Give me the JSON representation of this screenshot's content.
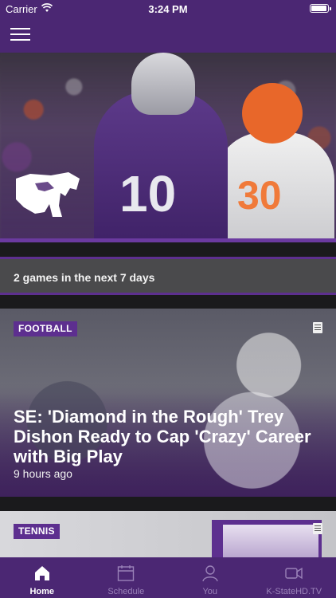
{
  "status": {
    "carrier": "Carrier",
    "time": "3:24 PM",
    "battery_level": 0.95
  },
  "nav": {
    "menu_icon": "hamburger-menu-icon"
  },
  "hero": {
    "logo": "powercat-logo",
    "jersey_left": "10",
    "jersey_right": "30"
  },
  "games_banner": {
    "text": "2 games in the next 7 days"
  },
  "stories": [
    {
      "category": "FOOTBALL",
      "headline": "SE: 'Diamond in the Rough' Trey Dishon Ready to Cap 'Crazy' Career with Big Play",
      "time": "9 hours ago",
      "icon": "document-icon"
    },
    {
      "category": "TENNIS",
      "icon": "document-icon"
    }
  ],
  "tabs": [
    {
      "label": "Home",
      "icon": "home-icon",
      "active": true
    },
    {
      "label": "Schedule",
      "icon": "calendar-icon",
      "active": false
    },
    {
      "label": "You",
      "icon": "person-icon",
      "active": false
    },
    {
      "label": "K-StateHD.TV",
      "icon": "video-camera-icon",
      "active": false
    }
  ],
  "colors": {
    "brand_purple": "#4b2773",
    "accent_purple": "#5d2f8f",
    "banner_gray": "#4a4a4c"
  }
}
